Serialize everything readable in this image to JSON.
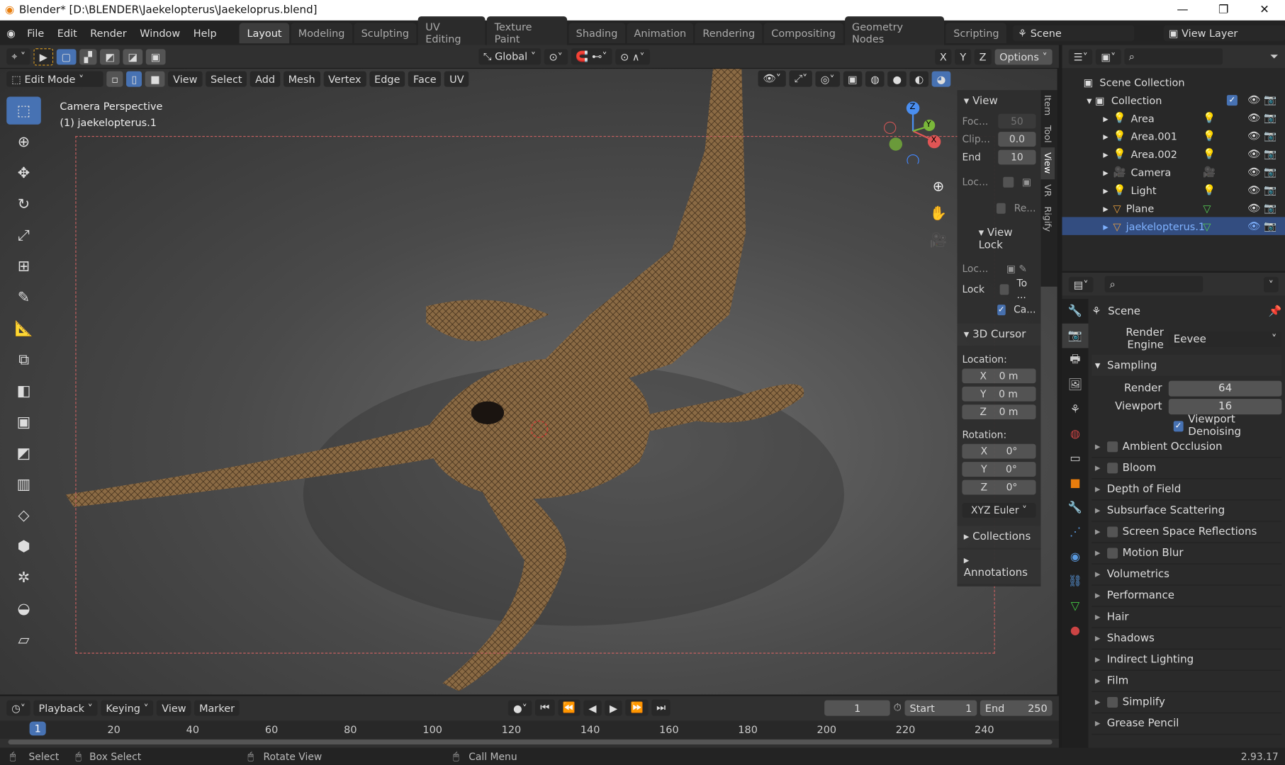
{
  "window": {
    "title": "Blender* [D:\\BLENDER\\Jaekelopterus\\Jaekeloprus.blend]",
    "minimize": "—",
    "restore": "❐",
    "close": "✕"
  },
  "menu": [
    "File",
    "Edit",
    "Render",
    "Window",
    "Help"
  ],
  "workspaces": [
    "Layout",
    "Modeling",
    "Sculpting",
    "UV Editing",
    "Texture Paint",
    "Shading",
    "Animation",
    "Rendering",
    "Compositing",
    "Geometry Nodes",
    "Scripting"
  ],
  "scene": "Scene",
  "view_layer": "View Layer",
  "tool_header": {
    "orientation": "Global",
    "options": "Options",
    "axes": [
      "X",
      "Y",
      "Z"
    ]
  },
  "viewport_header": {
    "mode": "Edit Mode",
    "menus": [
      "View",
      "Select",
      "Add",
      "Mesh",
      "Vertex",
      "Edge",
      "Face",
      "UV"
    ]
  },
  "viewport": {
    "perspective": "Camera Perspective",
    "object": "(1) jaekelopterus.1",
    "gizmo": {
      "x": "X",
      "y": "Y",
      "z": "Z"
    }
  },
  "npanel": {
    "tabs": [
      "Item",
      "Tool",
      "View",
      "VR",
      "Rigify"
    ],
    "active_tab": "View",
    "view": {
      "title": "View",
      "focal_label": "Foc...",
      "focal": "50",
      "clip_label": "Clip...",
      "clip_start": "0.0",
      "end_label": "End",
      "clip_end": "10",
      "loc_label": "Loc...",
      "re_label": "Re..."
    },
    "view_lock": {
      "title": "View Lock",
      "loc_label": "Loc...",
      "lock_label": "Lock",
      "to_label": "To ...",
      "ca_label": "Ca..."
    },
    "cursor": {
      "title": "3D Cursor",
      "location_label": "Location:",
      "loc": [
        [
          "X",
          "0 m"
        ],
        [
          "Y",
          "0 m"
        ],
        [
          "Z",
          "0 m"
        ]
      ],
      "rotation_label": "Rotation:",
      "rot": [
        [
          "X",
          "0°"
        ],
        [
          "Y",
          "0°"
        ],
        [
          "Z",
          "0°"
        ]
      ],
      "mode": "XYZ Euler"
    },
    "collections": "Collections",
    "annotations": "Annotations"
  },
  "outliner": {
    "root": "Scene Collection",
    "collection": "Collection",
    "items": [
      {
        "name": "Area",
        "icon": "light"
      },
      {
        "name": "Area.001",
        "icon": "light"
      },
      {
        "name": "Area.002",
        "icon": "light"
      },
      {
        "name": "Camera",
        "icon": "camera"
      },
      {
        "name": "Light",
        "icon": "light"
      },
      {
        "name": "Plane",
        "icon": "mesh"
      },
      {
        "name": "jaekelopterus.1",
        "icon": "mesh",
        "selected": true
      }
    ]
  },
  "properties": {
    "context": "Scene",
    "render_engine_label": "Render Engine",
    "render_engine": "Eevee",
    "sampling": {
      "title": "Sampling",
      "render_label": "Render",
      "render": "64",
      "viewport_label": "Viewport",
      "viewport": "16",
      "denoise": "Viewport Denoising"
    },
    "panels": [
      {
        "name": "Ambient Occlusion",
        "check": true
      },
      {
        "name": "Bloom",
        "check": true
      },
      {
        "name": "Depth of Field"
      },
      {
        "name": "Subsurface Scattering"
      },
      {
        "name": "Screen Space Reflections",
        "check": true
      },
      {
        "name": "Motion Blur",
        "check": true
      },
      {
        "name": "Volumetrics"
      },
      {
        "name": "Performance"
      },
      {
        "name": "Hair"
      },
      {
        "name": "Shadows"
      },
      {
        "name": "Indirect Lighting"
      },
      {
        "name": "Film"
      },
      {
        "name": "Simplify",
        "check": true
      },
      {
        "name": "Grease Pencil"
      }
    ]
  },
  "timeline": {
    "playback": "Playback",
    "keying": "Keying",
    "view": "View",
    "marker": "Marker",
    "current": "1",
    "start_label": "Start",
    "start": "1",
    "end_label": "End",
    "end": "250",
    "ticks": [
      "20",
      "40",
      "60",
      "80",
      "100",
      "120",
      "140",
      "160",
      "180",
      "200",
      "220",
      "240"
    ]
  },
  "status": {
    "select": "Select",
    "box_select": "Box Select",
    "rotate": "Rotate View",
    "call_menu": "Call Menu",
    "version": "2.93.17"
  },
  "colors": {
    "accent": "#4772b3",
    "selected_row": "#334d80"
  }
}
